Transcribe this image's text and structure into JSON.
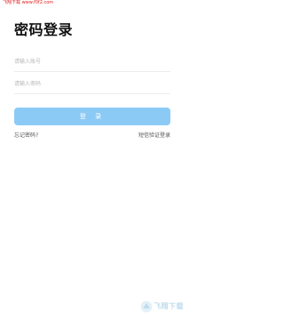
{
  "watermark": {
    "top_text": "飞翔下载 www.f0f2.com",
    "logo_text": "飞翔下载"
  },
  "header": {
    "title": "密码登录"
  },
  "form": {
    "account_placeholder": "请输入账号",
    "account_value": "",
    "password_placeholder": "请输入密码",
    "password_value": "",
    "login_label": "登 录"
  },
  "links": {
    "forgot_password": "忘记密码?",
    "sms_login": "短信验证登录"
  },
  "colors": {
    "button_bg": "#8ccaf6",
    "divider": "#ececec",
    "placeholder": "#b8b8b8",
    "watermark_red": "#e02020"
  }
}
